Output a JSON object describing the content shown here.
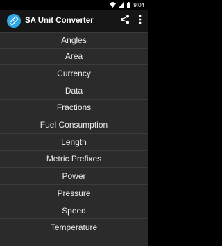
{
  "status_bar": {
    "time": "9:04",
    "icons": [
      "wifi-icon",
      "signal-icon",
      "battery-icon"
    ]
  },
  "app_bar": {
    "title": "SA Unit Converter",
    "logo_icon": "ruler-icon",
    "actions": [
      "share-icon",
      "overflow-menu-icon"
    ]
  },
  "colors": {
    "status_bar_bg": "#000000",
    "app_bar_bg": "#161616",
    "list_bg": "#2b2b2b",
    "accent": "#2fa7e6",
    "text": "#ececec"
  },
  "categories": [
    {
      "label": "Angles"
    },
    {
      "label": "Area"
    },
    {
      "label": "Currency"
    },
    {
      "label": "Data"
    },
    {
      "label": "Fractions"
    },
    {
      "label": "Fuel Consumption"
    },
    {
      "label": "Length"
    },
    {
      "label": "Metric Prefixes"
    },
    {
      "label": "Power"
    },
    {
      "label": "Pressure"
    },
    {
      "label": "Speed"
    },
    {
      "label": "Temperature"
    }
  ]
}
